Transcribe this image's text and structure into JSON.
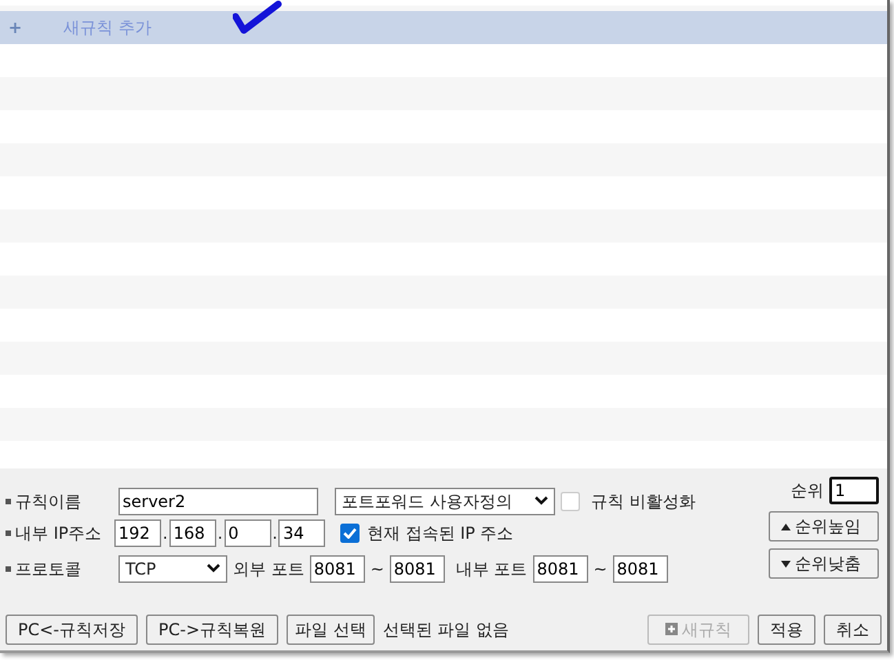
{
  "rule_list": [
    {
      "icon": "+",
      "label": "새규칙 추가",
      "selected": true
    }
  ],
  "form": {
    "priority_label": "순위",
    "priority_value": "1",
    "name_label": "규칙이름",
    "name_value": "server2",
    "type_value": "포트포워드 사용자정의",
    "disable_label": "규칙 비활성화",
    "disable_checked": false,
    "ip_label": "내부 IP주소",
    "ip_parts": [
      "192",
      "168",
      "0",
      "34"
    ],
    "ip_separator": ".",
    "current_ip_label": "현재 접속된 IP 주소",
    "current_ip_checked": true,
    "protocol_label": "프로토콜",
    "protocol_value": "TCP",
    "ext_port_label": "외부 포트",
    "ext_from": "8081",
    "ext_to": "8081",
    "int_port_label": "내부 포트",
    "int_from": "8081",
    "int_to": "8081",
    "tilde": "~",
    "up_button": "순위높임",
    "down_button": "순위낮춤"
  },
  "footer": {
    "save_button": "PC<-규칙저장",
    "restore_button": "PC->규칙복원",
    "file_button": "파일 선택",
    "file_status": "선택된 파일 없음",
    "new_button": "새규칙",
    "new_disabled": true,
    "apply_button": "적용",
    "cancel_button": "취소"
  }
}
